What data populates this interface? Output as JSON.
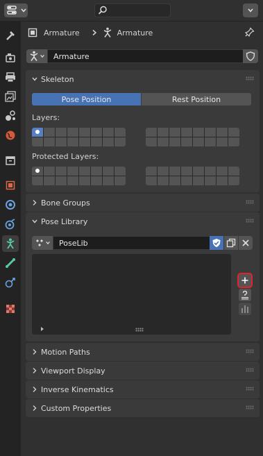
{
  "breadcrumb": {
    "object_name": "Armature",
    "data_name": "Armature"
  },
  "datablock": {
    "name": "Armature"
  },
  "skeleton": {
    "title": "Skeleton",
    "pose_position_label": "Pose Position",
    "rest_position_label": "Rest Position",
    "layers_label": "Layers:",
    "protected_layers_label": "Protected Layers:"
  },
  "bone_groups": {
    "title": "Bone Groups"
  },
  "pose_library": {
    "title": "Pose Library",
    "name": "PoseLib"
  },
  "motion_paths": {
    "title": "Motion Paths"
  },
  "viewport_display": {
    "title": "Viewport Display"
  },
  "inverse_kinematics": {
    "title": "Inverse Kinematics"
  },
  "custom_properties": {
    "title": "Custom Properties"
  },
  "colors": {
    "accent_blue": "#4772b3",
    "add_button_outline": "#e0242f",
    "panel_bg": "#3a3a3a"
  },
  "tabs": [
    "tool-icon",
    "render-icon",
    "output-icon",
    "view-layer-icon",
    "scene-icon",
    "world-icon",
    "collection-icon",
    "object-icon",
    "modifier-icon",
    "physics-icon",
    "armature-data-icon",
    "bone-icon",
    "bone-constraint-icon",
    "texture-icon"
  ]
}
